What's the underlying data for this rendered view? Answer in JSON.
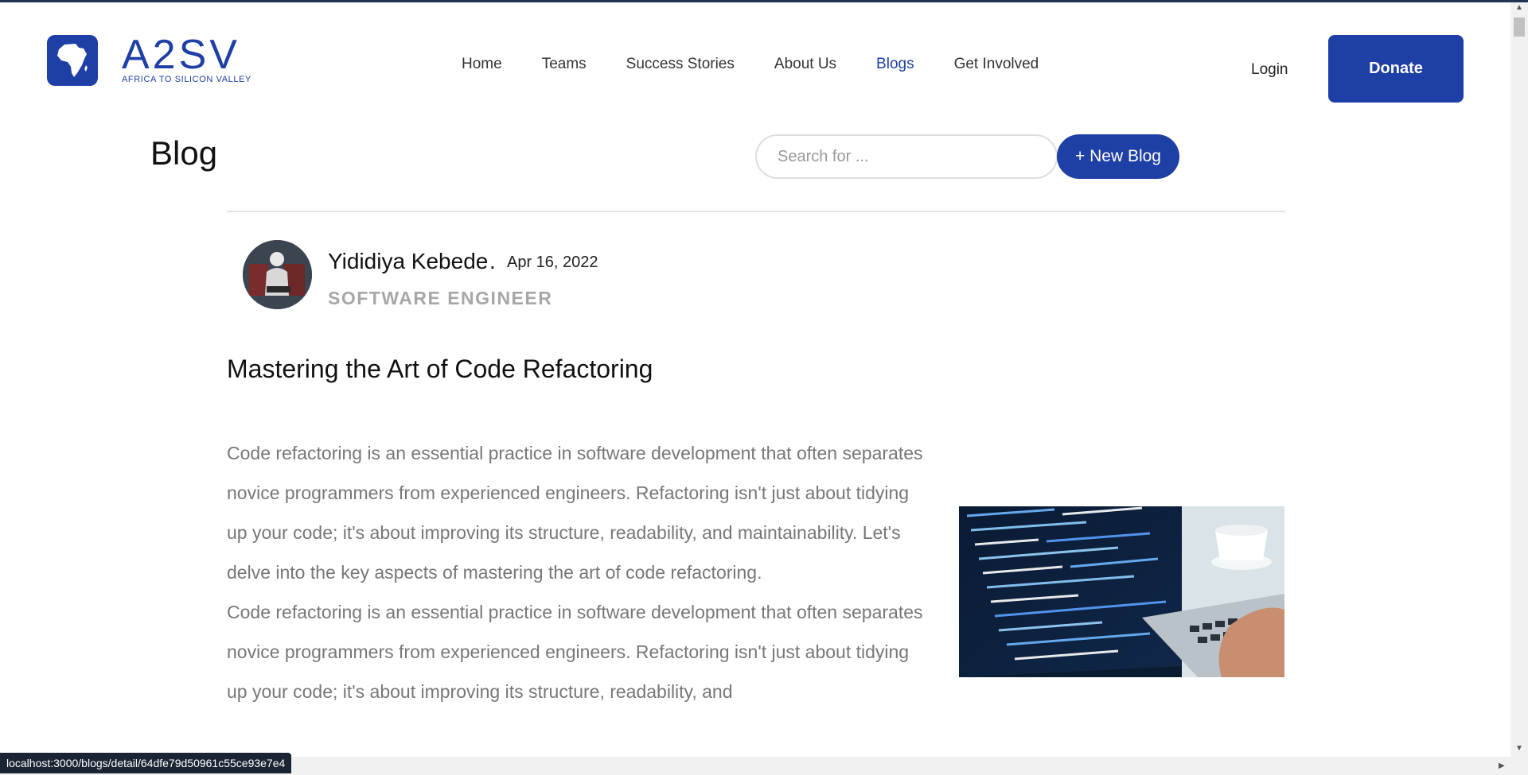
{
  "header": {
    "logo": {
      "word": "A2SV",
      "subtitle": "AFRICA TO SILICON VALLEY"
    },
    "nav": [
      {
        "label": "Home",
        "active": false
      },
      {
        "label": "Teams",
        "active": false
      },
      {
        "label": "Success Stories",
        "active": false
      },
      {
        "label": "About Us",
        "active": false
      },
      {
        "label": "Blogs",
        "active": true
      },
      {
        "label": "Get Involved",
        "active": false
      }
    ],
    "login_label": "Login",
    "donate_label": "Donate"
  },
  "blog_toolbar": {
    "title": "Blog",
    "search_placeholder": "Search for ...",
    "new_blog_label": "+ New Blog"
  },
  "post": {
    "author_name": "Yididiya Kebede",
    "separator": ".",
    "date": "Apr 16, 2022",
    "author_role": "SOFTWARE ENGINEER",
    "title": "Mastering the Art of Code Refactoring",
    "paragraphs": [
      "Code refactoring is an essential practice in software development that often separates novice programmers from experienced engineers. Refactoring isn't just about tidying up your code; it's about improving its structure, readability, and maintainability. Let's delve into the key aspects of mastering the art of code refactoring.",
      "Code refactoring is an essential practice in software development that often separates novice programmers from experienced engineers. Refactoring isn't just about tidying up your code; it's about improving its structure, readability, and"
    ]
  },
  "status_bar": {
    "url": "localhost:3000/blogs/detail/64dfe79d50961c55ce93e7e4"
  },
  "colors": {
    "brand": "#1e3fa6",
    "text_muted": "#777777",
    "role_gray": "#a7a7a7"
  },
  "icons": [
    "africa-map-icon",
    "laptop-code-image",
    "scroll-up-arrow-icon",
    "scroll-down-arrow-icon"
  ]
}
